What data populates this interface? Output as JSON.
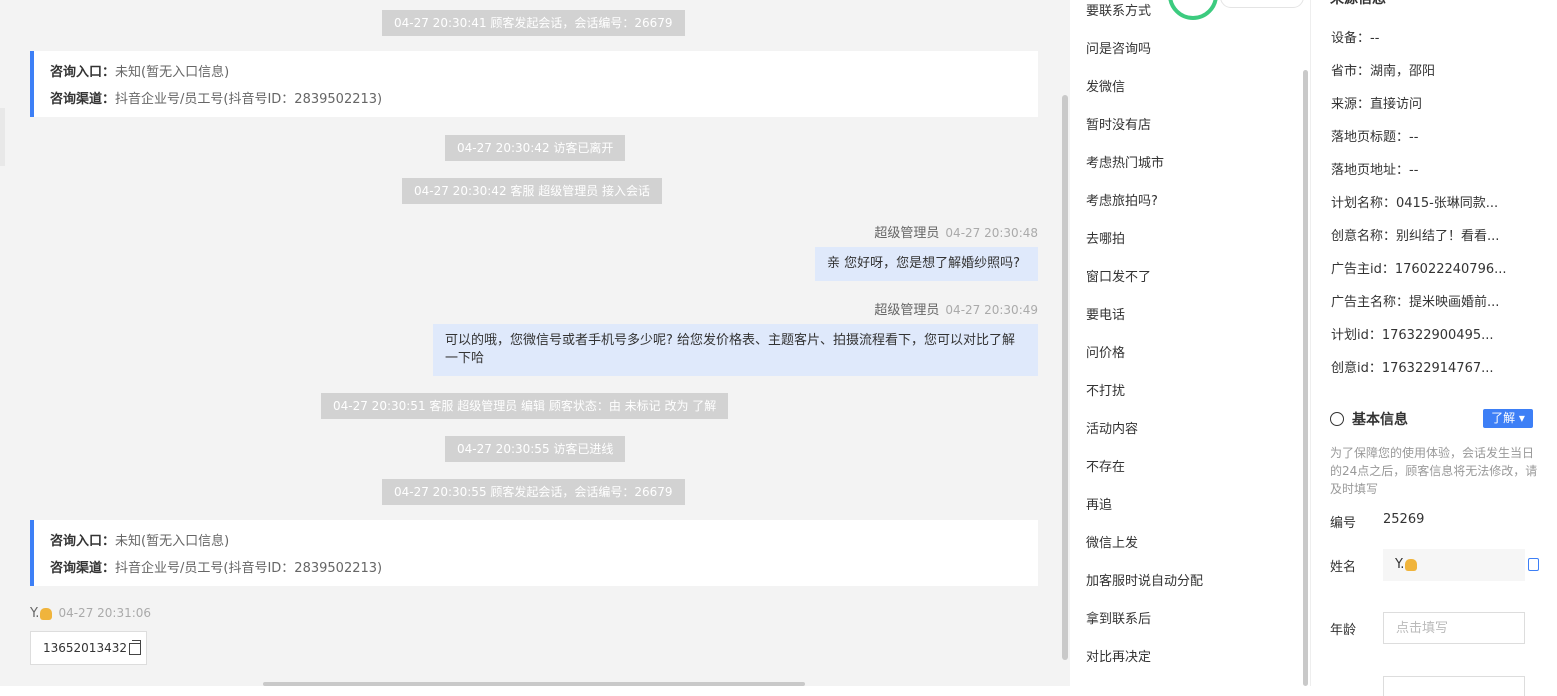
{
  "chat": {
    "sys1": "04-27 20:30:41 顾客发起会话，会话编号：26679",
    "card1": {
      "entry_label": "咨询入口：",
      "entry_value": "未知(暂无入口信息)",
      "channel_label": "咨询渠道：",
      "channel_value": "抖音企业号/员工号(抖音号ID：2839502213)"
    },
    "sys2": "04-27 20:30:42 访客已离开",
    "sys3": "04-27 20:30:42 客服 超级管理员 接入会话",
    "msg1": {
      "sender": "超级管理员",
      "time": "04-27 20:30:48",
      "text": "亲 您好呀，您是想了解婚纱照吗?"
    },
    "msg2": {
      "sender": "超级管理员",
      "time": "04-27 20:30:49",
      "text": "可以的哦，您微信号或者手机号多少呢? 给您发价格表、主题客片、拍摄流程看下，您可以对比了解一下哈"
    },
    "sys4": "04-27 20:30:51 客服 超级管理员 编辑 顾客状态：由 未标记 改为 了解",
    "sys5": "04-27 20:30:55 访客已进线",
    "sys6": "04-27 20:30:55 顾客发起会话，会话编号：26679",
    "card2": {
      "entry_label": "咨询入口：",
      "entry_value": "未知(暂无入口信息)",
      "channel_label": "咨询渠道：",
      "channel_value": "抖音企业号/员工号(抖音号ID：2839502213)"
    },
    "msg3": {
      "sender": "Y.",
      "time": "04-27 20:31:06",
      "text": "13652013432"
    }
  },
  "quick_replies": [
    "要联系方式",
    "问是咨询吗",
    "发微信",
    "暂时没有店",
    "考虑热门城市",
    "考虑旅拍吗?",
    "去哪拍",
    "窗口发不了",
    "要电话",
    "问价格",
    "不打扰",
    "活动内容",
    "不存在",
    "再追",
    "微信上发",
    "加客服时说自动分配",
    "拿到联系后",
    "对比再决定"
  ],
  "source_info": {
    "title": "来源信息",
    "lines": [
      "设备：--",
      "省市：湖南，邵阳",
      "来源：直接访问",
      "落地页标题：--",
      "落地页地址：--",
      "计划名称：0415-张琳同款...",
      "创意名称：别纠结了！看看...",
      "广告主id：176022240796...",
      "广告主名称：提米映画婚前...",
      "计划id：176322900495...",
      "创意id：176322914767..."
    ]
  },
  "basic_info": {
    "title": "基本信息",
    "status_tag": "了解",
    "note": "为了保障您的使用体验，会话发生当日的24点之后，顾客信息将无法修改，请及时填写",
    "id_label": "编号",
    "id_value": "25269",
    "name_label": "姓名",
    "name_value": "Y.",
    "age_label": "年龄",
    "age_placeholder": "点击填写"
  },
  "colors": {
    "accent": "#3d7ff6",
    "bubble": "#dfe9fb",
    "system": "#d2d2d2"
  }
}
